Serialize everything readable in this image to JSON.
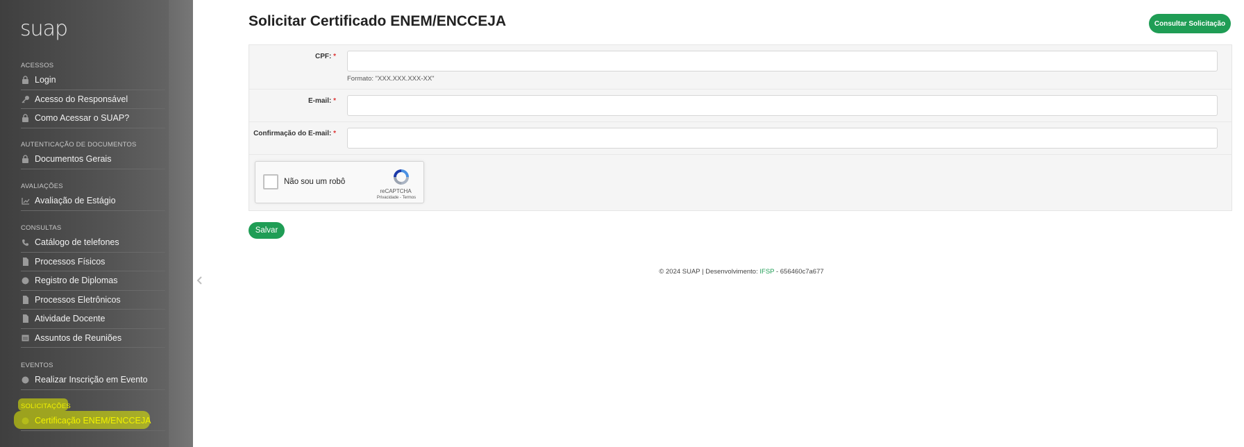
{
  "sidebar": {
    "logo": "suap",
    "sections": [
      {
        "title": "Acessos",
        "items": [
          {
            "label": "Login",
            "icon": "lock-icon"
          },
          {
            "label": "Acesso do Responsável",
            "icon": "key-icon"
          },
          {
            "label": "Como Acessar o SUAP?",
            "icon": "lock-icon"
          }
        ]
      },
      {
        "title": "Autenticação de Documentos",
        "items": [
          {
            "label": "Documentos Gerais",
            "icon": "lock-icon"
          }
        ]
      },
      {
        "title": "Avaliações",
        "items": [
          {
            "label": "Avaliação de Estágio",
            "icon": "chart-icon"
          }
        ]
      },
      {
        "title": "Consultas",
        "items": [
          {
            "label": "Catálogo de telefones",
            "icon": "phone-icon"
          },
          {
            "label": "Processos Físicos",
            "icon": "file-icon"
          },
          {
            "label": "Registro de Diplomas",
            "icon": "circle-icon"
          },
          {
            "label": "Processos Eletrônicos",
            "icon": "file-icon"
          },
          {
            "label": "Atividade Docente",
            "icon": "file-icon"
          },
          {
            "label": "Assuntos de Reuniões",
            "icon": "calendar-icon"
          }
        ]
      },
      {
        "title": "Eventos",
        "items": [
          {
            "label": "Realizar Inscrição em Evento",
            "icon": "circle-icon"
          }
        ]
      },
      {
        "title": "Solicitações",
        "items": [
          {
            "label": "Certificação ENEM/ENCCEJA",
            "icon": "circle-icon"
          }
        ]
      }
    ]
  },
  "main": {
    "title": "Solicitar Certificado ENEM/ENCCEJA",
    "consult_button": "Consultar Solicitação",
    "form": {
      "cpf_label": "CPF:",
      "cpf_help": "Formato: \"XXX.XXX.XXX-XX\"",
      "email_label": "E-mail:",
      "email_confirm_label": "Confirmação do E-mail:",
      "required_mark": "*",
      "cpf_value": "",
      "email_value": "",
      "email_confirm_value": ""
    },
    "captcha": {
      "label": "Não sou um robô",
      "brand": "reCAPTCHA",
      "terms": "Privacidade - Termos"
    },
    "save_button": "Salvar",
    "footer": {
      "prefix": "© 2024 SUAP | Desenvolvimento: ",
      "org": "IFSP",
      "suffix": " - 656460c7a677"
    }
  },
  "colors": {
    "accent": "#1f9d55",
    "highlight": "#e6f000"
  }
}
